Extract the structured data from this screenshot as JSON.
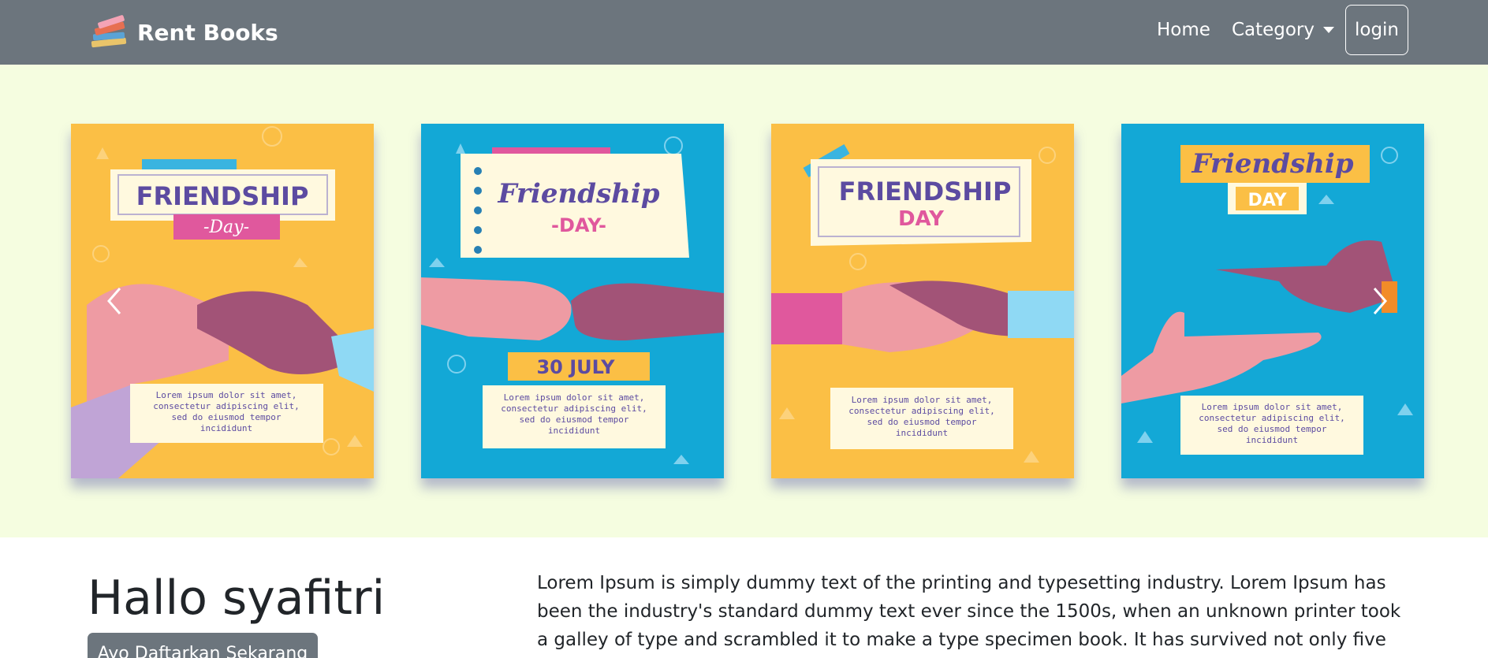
{
  "navbar": {
    "brand": "Rent Books",
    "brand_logo": "books-stack-icon",
    "links": {
      "home": "Home",
      "category": "Category",
      "login": "login"
    },
    "background": "#6c757d"
  },
  "carousel": {
    "background": "#f5fde0",
    "slides": [
      {
        "title": "FRIENDSHIP",
        "subtitle": "-Day-",
        "body": [
          "Lorem ipsum dolor sit amet,",
          "consectetur adipiscing elit,",
          "sed do eiusmod tempor",
          "incididunt"
        ],
        "bg": "#fbbf45"
      },
      {
        "title": "Friendship",
        "subtitle": "-DAY-",
        "date": "30 JULY",
        "body": [
          "Lorem ipsum dolor sit amet,",
          "consectetur adipiscing elit,",
          "sed do eiusmod tempor",
          "incididunt"
        ],
        "bg": "#13a8d6"
      },
      {
        "title": "FRIENDSHIP",
        "subtitle": "DAY",
        "body": [
          "Lorem ipsum dolor sit amet,",
          "consectetur adipiscing elit,",
          "sed do eiusmod tempor",
          "incididunt"
        ],
        "bg": "#fbbf45"
      },
      {
        "title": "Friendship",
        "subtitle": "DAY",
        "body": [
          "Lorem ipsum dolor sit amet,",
          "consectetur adipiscing elit,",
          "sed do eiusmod tempor",
          "incididunt"
        ],
        "bg": "#13a8d6"
      }
    ],
    "prev_icon": "chevron-left-icon",
    "next_icon": "chevron-right-icon"
  },
  "main": {
    "greeting": "Hallo syafitri",
    "register_button": "Ayo Daftarkan Sekarang",
    "description": "Lorem Ipsum is simply dummy text of the printing and typesetting industry. Lorem Ipsum has been the industry's standard dummy text ever since the 1500s, when an unknown printer took a galley of type and scrambled it to make a type specimen book. It has survived not only five centuries, but also the leap"
  }
}
